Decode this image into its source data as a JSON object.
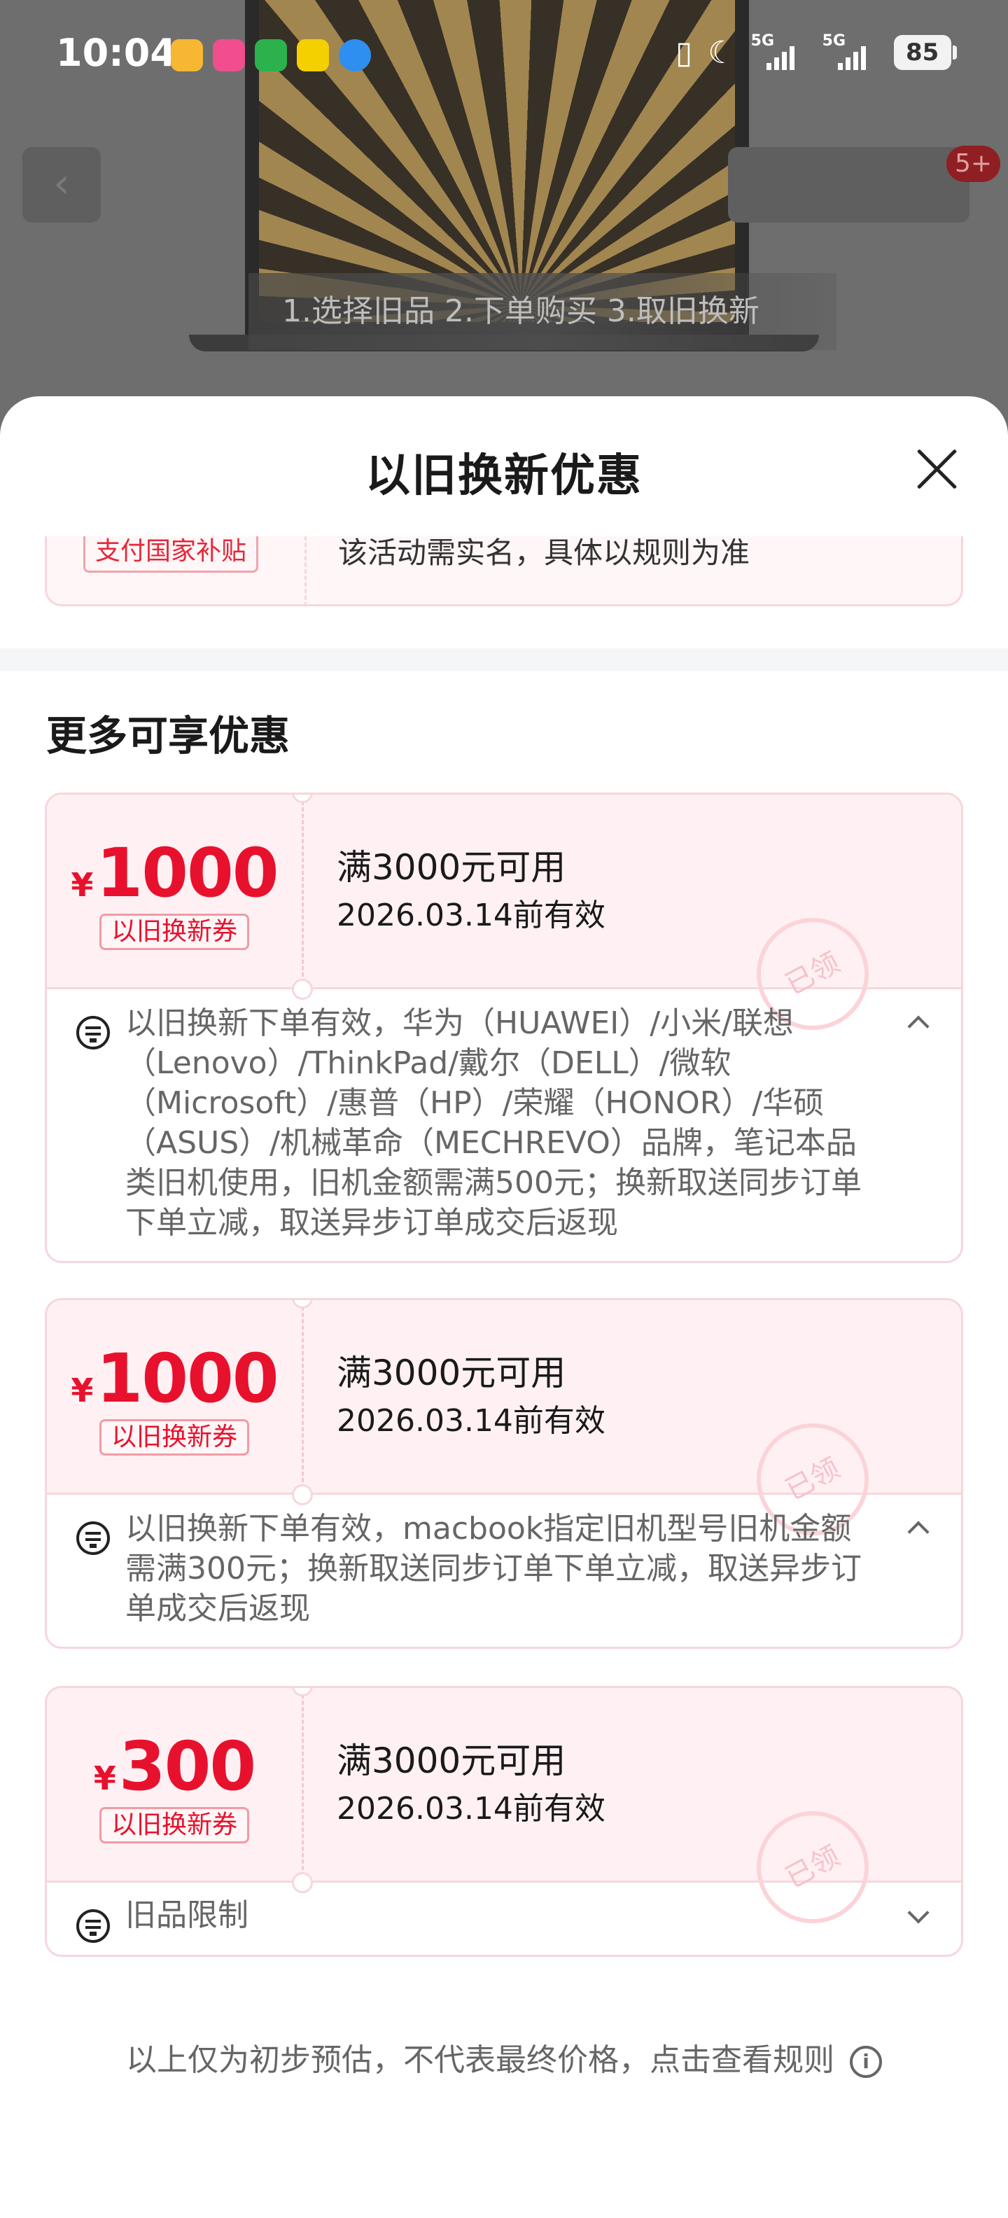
{
  "status_bar": {
    "time": "10:04",
    "battery": "85",
    "net1": "5G",
    "net2": "5G"
  },
  "background": {
    "steps_text": "1.选择旧品 2.下单购买 3.取旧换新",
    "badge": "5+"
  },
  "sheet": {
    "title": "以旧换新优惠",
    "prev_tag": "支付国家补贴",
    "prev_text": "该活动需实名，具体以规则为准",
    "section_title": "更多可享优惠",
    "coupons": [
      {
        "currency": "¥",
        "amount": "1000",
        "type": "以旧换新券",
        "condition": "满3000元可用",
        "expiry": "2026.03.14前有效",
        "stamp": "已领",
        "desc": "以旧换新下单有效，华为（HUAWEI）/小米/联想（Lenovo）/ThinkPad/戴尔（DELL）/微软（Microsoft）/惠普（HP）/荣耀（HONOR）/华硕（ASUS）/机械革命（MECHREVO）品牌，笔记本品类旧机使用，旧机金额需满500元；换新取送同步订单下单立减，取送异步订单成交后返现"
      },
      {
        "currency": "¥",
        "amount": "1000",
        "type": "以旧换新券",
        "condition": "满3000元可用",
        "expiry": "2026.03.14前有效",
        "stamp": "已领",
        "desc": "以旧换新下单有效，macbook指定旧机型号旧机金额需满300元；换新取送同步订单下单立减，取送异步订单成交后返现"
      },
      {
        "currency": "¥",
        "amount": "300",
        "type": "以旧换新券",
        "condition": "满3000元可用",
        "expiry": "2026.03.14前有效",
        "stamp": "已领",
        "desc": "旧品限制"
      }
    ],
    "footer_note": "以上仅为初步预估，不代表最终价格，点击查看规则",
    "info_icon_glyph": "i"
  },
  "icons": {
    "back": "chevron-left-icon",
    "close": "close-icon",
    "coupon_desc": "ticket-icon",
    "expand": "chevron-up-icon",
    "collapse": "chevron-down-icon",
    "info": "info-icon"
  },
  "colors": {
    "accent_red": "#e8112d",
    "coupon_bg": "#fff1f3",
    "coupon_border": "#f6d7dc",
    "overlay": "#6e6e6e"
  }
}
